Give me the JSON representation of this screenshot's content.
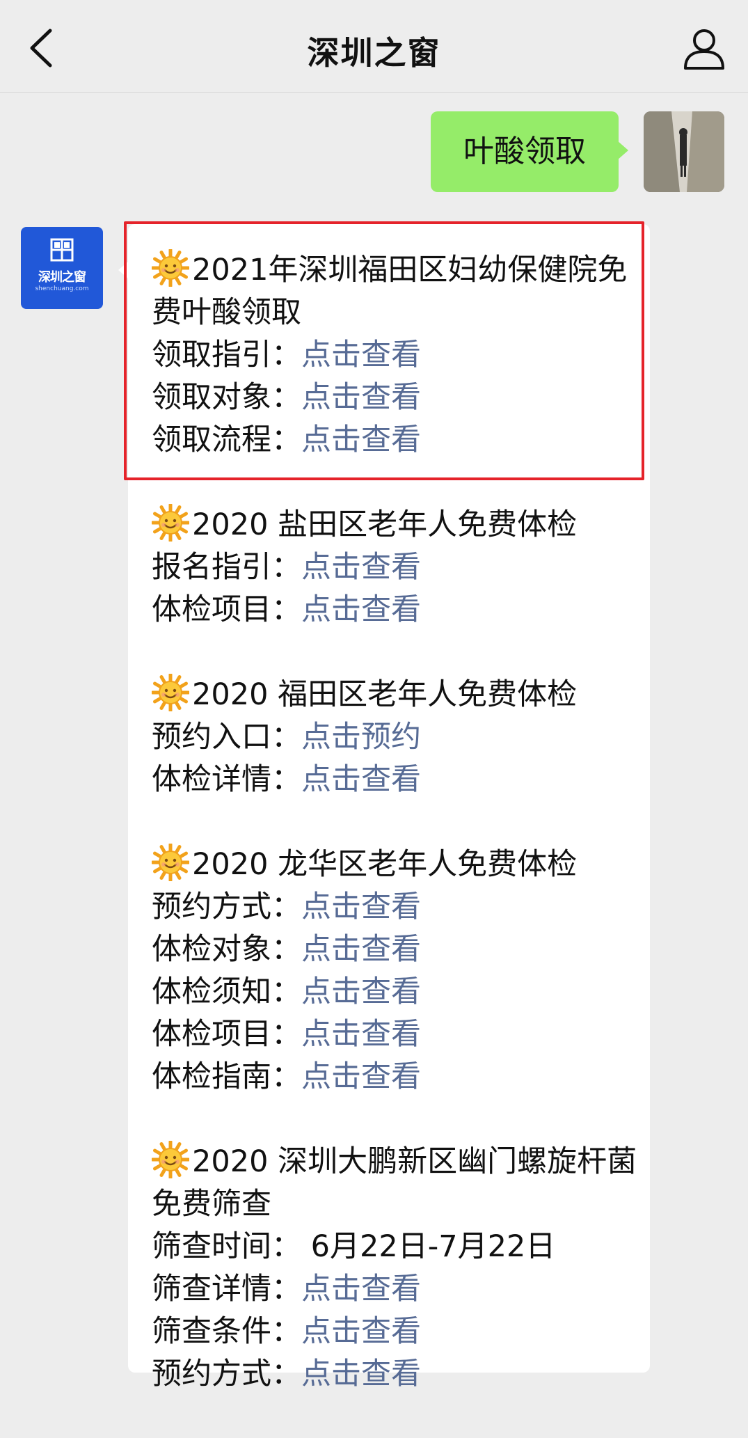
{
  "nav": {
    "title": "深圳之窗",
    "back_icon": "chevron-left-icon",
    "user_icon": "user-icon"
  },
  "outgoing_message": {
    "text": "叶酸领取"
  },
  "bot": {
    "logo_text": "深圳之窗",
    "logo_url": "shenchuang.com"
  },
  "blocks": [
    {
      "emoji": "sun-icon",
      "title": "2021年深圳福田区妇幼保健院免费叶酸领取",
      "items": [
        {
          "label": "领取指引：",
          "link": "点击查看"
        },
        {
          "label": "领取对象：",
          "link": "点击查看"
        },
        {
          "label": "领取流程：",
          "link": "点击查看"
        }
      ]
    },
    {
      "emoji": "sun-icon",
      "title": "2020 盐田区老年人免费体检",
      "items": [
        {
          "label": "报名指引：",
          "link": "点击查看"
        },
        {
          "label": "体检项目：",
          "link": "点击查看"
        }
      ]
    },
    {
      "emoji": "sun-icon",
      "title": "2020 福田区老年人免费体检",
      "items": [
        {
          "label": "预约入口：",
          "link": "点击预约"
        },
        {
          "label": "体检详情：",
          "link": "点击查看"
        }
      ]
    },
    {
      "emoji": "sun-icon",
      "title": "2020 龙华区老年人免费体检",
      "items": [
        {
          "label": "预约方式：",
          "link": "点击查看"
        },
        {
          "label": "体检对象：",
          "link": "点击查看"
        },
        {
          "label": "体检须知：",
          "link": "点击查看"
        },
        {
          "label": "体检项目：",
          "link": "点击查看"
        },
        {
          "label": "体检指南：",
          "link": "点击查看"
        }
      ]
    },
    {
      "emoji": "sun-icon",
      "title": "2020 深圳大鹏新区幽门螺旋杆菌免费筛查",
      "items": [
        {
          "label": "筛查时间： 6月22日-7月22日",
          "link": ""
        },
        {
          "label": "筛查详情：",
          "link": "点击查看"
        },
        {
          "label": "筛查条件：",
          "link": "点击查看"
        },
        {
          "label": "预约方式：",
          "link": "点击查看"
        }
      ]
    }
  ],
  "colors": {
    "link": "#576b95",
    "bubble_out": "#95ec69",
    "highlight": "#e5232a",
    "brand": "#2158d8"
  }
}
